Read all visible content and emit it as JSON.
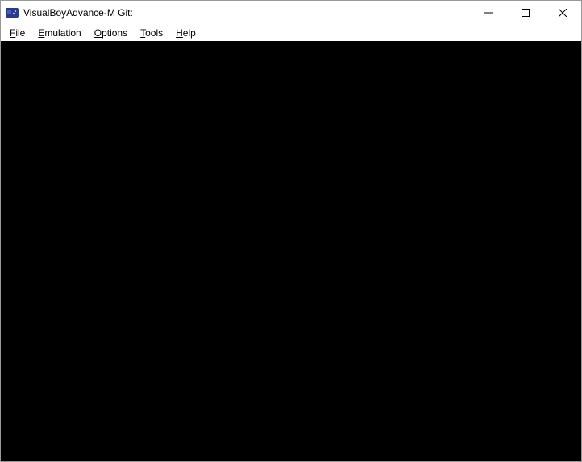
{
  "window": {
    "title": "VisualBoyAdvance-M Git:"
  },
  "menu": {
    "file": "File",
    "emulation": "Emulation",
    "options": "Options",
    "tools": "Tools",
    "help": "Help"
  }
}
